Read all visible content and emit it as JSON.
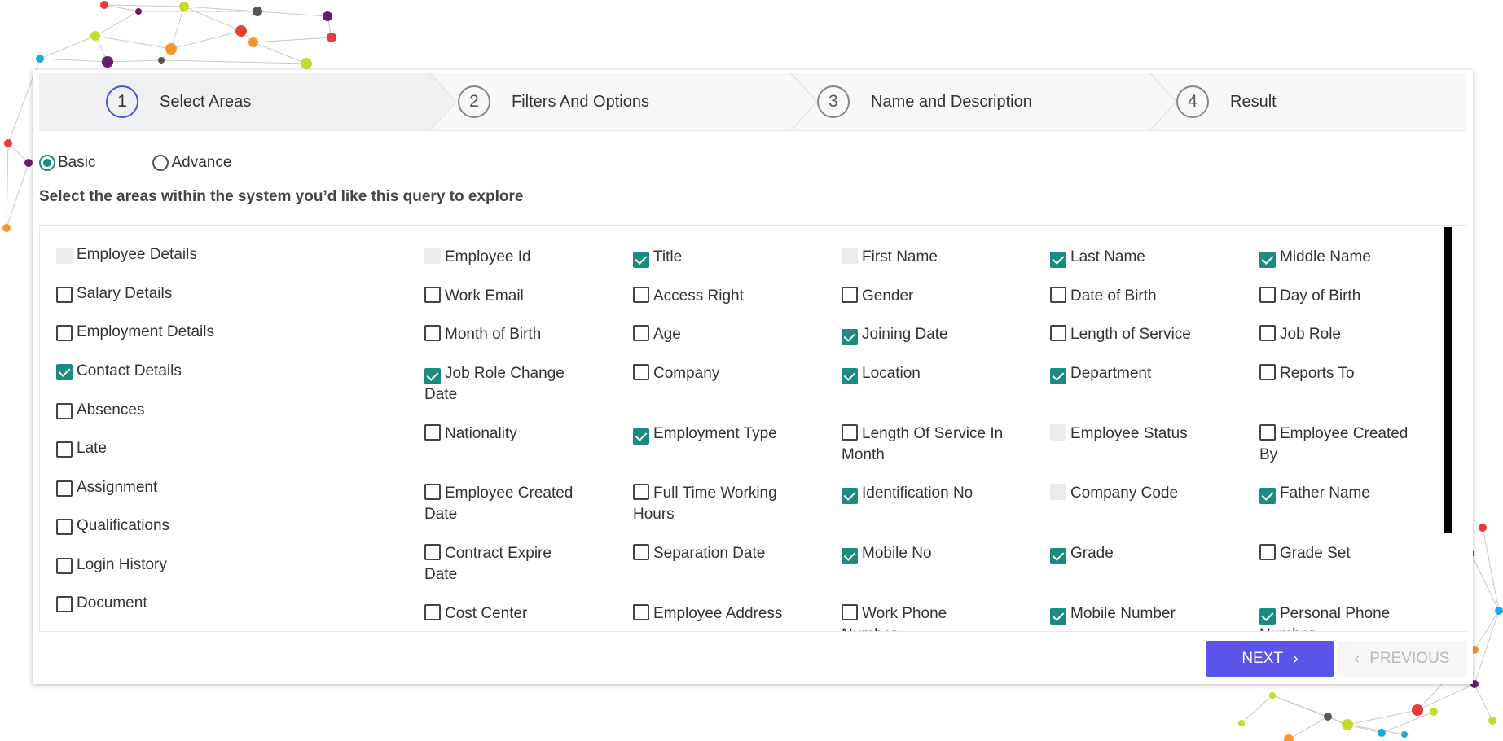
{
  "stepper": {
    "steps": [
      {
        "number": "1",
        "label": "Select Areas",
        "active": true
      },
      {
        "number": "2",
        "label": "Filters And Options",
        "active": false
      },
      {
        "number": "3",
        "label": "Name and Description",
        "active": false
      },
      {
        "number": "4",
        "label": "Result",
        "active": false
      }
    ]
  },
  "mode": {
    "options": [
      {
        "label": "Basic",
        "selected": true
      },
      {
        "label": "Advance",
        "selected": false
      }
    ]
  },
  "instruction": "Select the areas within the system you’d like this query to explore",
  "areas": [
    {
      "label": "Employee Details",
      "state": "disabled"
    },
    {
      "label": "Salary Details",
      "state": "unchecked"
    },
    {
      "label": "Employment Details",
      "state": "unchecked"
    },
    {
      "label": "Contact Details",
      "state": "checked"
    },
    {
      "label": "Absences",
      "state": "unchecked"
    },
    {
      "label": "Late",
      "state": "unchecked"
    },
    {
      "label": "Assignment",
      "state": "unchecked"
    },
    {
      "label": "Qualifications",
      "state": "unchecked"
    },
    {
      "label": "Login History",
      "state": "unchecked"
    },
    {
      "label": "Document",
      "state": "unchecked"
    }
  ],
  "fields": [
    [
      {
        "label": "Employee Id",
        "state": "disabled"
      },
      {
        "label": "Title",
        "state": "checked"
      },
      {
        "label": "First Name",
        "state": "disabled"
      },
      {
        "label": "Last Name",
        "state": "checked"
      },
      {
        "label": "Middle Name",
        "state": "checked"
      }
    ],
    [
      {
        "label": "Work Email",
        "state": "unchecked"
      },
      {
        "label": "Access Right",
        "state": "unchecked"
      },
      {
        "label": "Gender",
        "state": "unchecked"
      },
      {
        "label": "Date of Birth",
        "state": "unchecked"
      },
      {
        "label": "Day of Birth",
        "state": "unchecked"
      }
    ],
    [
      {
        "label": "Month of Birth",
        "state": "unchecked"
      },
      {
        "label": "Age",
        "state": "unchecked"
      },
      {
        "label": "Joining Date",
        "state": "checked"
      },
      {
        "label": "Length of Service",
        "state": "unchecked"
      },
      {
        "label": "Job Role",
        "state": "unchecked"
      }
    ],
    [
      {
        "label": "Job Role Change Date",
        "state": "checked"
      },
      {
        "label": "Company",
        "state": "unchecked"
      },
      {
        "label": "Location",
        "state": "checked"
      },
      {
        "label": "Department",
        "state": "checked"
      },
      {
        "label": "Reports To",
        "state": "unchecked"
      }
    ],
    [
      {
        "label": "Nationality",
        "state": "unchecked"
      },
      {
        "label": "Employment Type",
        "state": "checked"
      },
      {
        "label": "Length Of Service In Month",
        "state": "unchecked"
      },
      {
        "label": "Employee Status",
        "state": "disabled"
      },
      {
        "label": "Employee Created By",
        "state": "unchecked"
      }
    ],
    [
      {
        "label": "Employee Created Date",
        "state": "unchecked"
      },
      {
        "label": "Full Time Working Hours",
        "state": "unchecked"
      },
      {
        "label": "Identification No",
        "state": "checked"
      },
      {
        "label": "Company Code",
        "state": "disabled"
      },
      {
        "label": "Father Name",
        "state": "checked"
      }
    ],
    [
      {
        "label": "Contract Expire Date",
        "state": "unchecked"
      },
      {
        "label": "Separation Date",
        "state": "unchecked"
      },
      {
        "label": "Mobile No",
        "state": "checked"
      },
      {
        "label": "Grade",
        "state": "checked"
      },
      {
        "label": "Grade Set",
        "state": "unchecked"
      }
    ],
    [
      {
        "label": "Cost Center",
        "state": "unchecked"
      },
      {
        "label": "Employee Address",
        "state": "unchecked"
      },
      {
        "label": "Work Phone Number",
        "state": "unchecked"
      },
      {
        "label": "Mobile Number",
        "state": "checked"
      },
      {
        "label": "Personal Phone Number",
        "state": "checked"
      }
    ]
  ],
  "buttons": {
    "next": "NEXT",
    "previous": "PREVIOUS"
  },
  "colors": {
    "accent": "#1a8c7f",
    "primary_button": "#5a55e8",
    "active_step_ring": "#4b57d8"
  }
}
